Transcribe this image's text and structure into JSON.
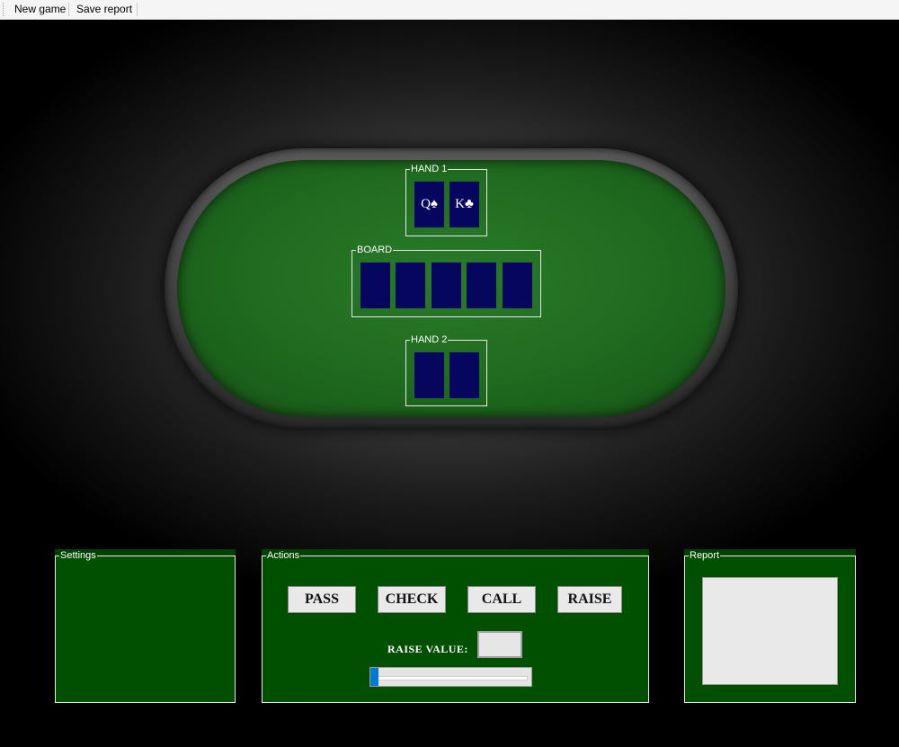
{
  "menu": {
    "new_game": "New game",
    "save_report": "Save report"
  },
  "table": {
    "hand1": {
      "legend": "HAND 1",
      "cards": [
        "Q♠",
        "K♣"
      ]
    },
    "board": {
      "legend": "BOARD",
      "cards": [
        "",
        "",
        "",
        "",
        ""
      ]
    },
    "hand2": {
      "legend": "HAND 2",
      "cards": [
        "",
        ""
      ]
    }
  },
  "settings": {
    "legend": "Settings"
  },
  "actions": {
    "legend": "Actions",
    "pass": "PASS",
    "check": "CHECK",
    "call": "CALL",
    "raise": "RAISE",
    "raise_value_label": "RAISE VALUE:",
    "raise_value": "",
    "slider_value": 0
  },
  "report": {
    "legend": "Report",
    "text": ""
  },
  "colors": {
    "felt": "#1f6a1f",
    "panel": "#015001",
    "card_back": "#06065e",
    "slider_accent": "#0078d7"
  }
}
